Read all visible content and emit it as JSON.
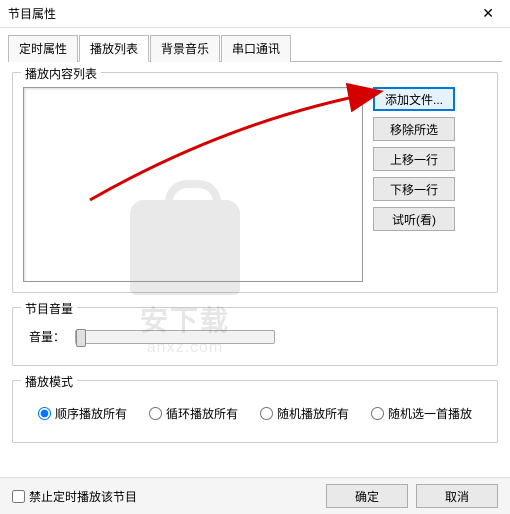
{
  "window": {
    "title": "节目属性"
  },
  "tabs": {
    "items": [
      {
        "label": "定时属性"
      },
      {
        "label": "播放列表"
      },
      {
        "label": "背景音乐"
      },
      {
        "label": "串口通讯"
      }
    ],
    "active_index": 1
  },
  "playlist_group": {
    "label": "播放内容列表",
    "buttons": {
      "add_file": "添加文件...",
      "remove_selected": "移除所选",
      "move_up": "上移一行",
      "move_down": "下移一行",
      "preview": "试听(看)"
    }
  },
  "volume_group": {
    "label": "节目音量",
    "slider_label": "音量："
  },
  "playmode_group": {
    "label": "播放模式",
    "options": [
      {
        "label": "顺序播放所有",
        "checked": true
      },
      {
        "label": "循环播放所有",
        "checked": false
      },
      {
        "label": "随机播放所有",
        "checked": false
      },
      {
        "label": "随机选一首播放",
        "checked": false
      }
    ]
  },
  "footer": {
    "checkbox_label": "禁止定时播放该节目",
    "ok": "确定",
    "cancel": "取消"
  },
  "watermark": {
    "title": "安下载",
    "sub": "anxz.com"
  }
}
